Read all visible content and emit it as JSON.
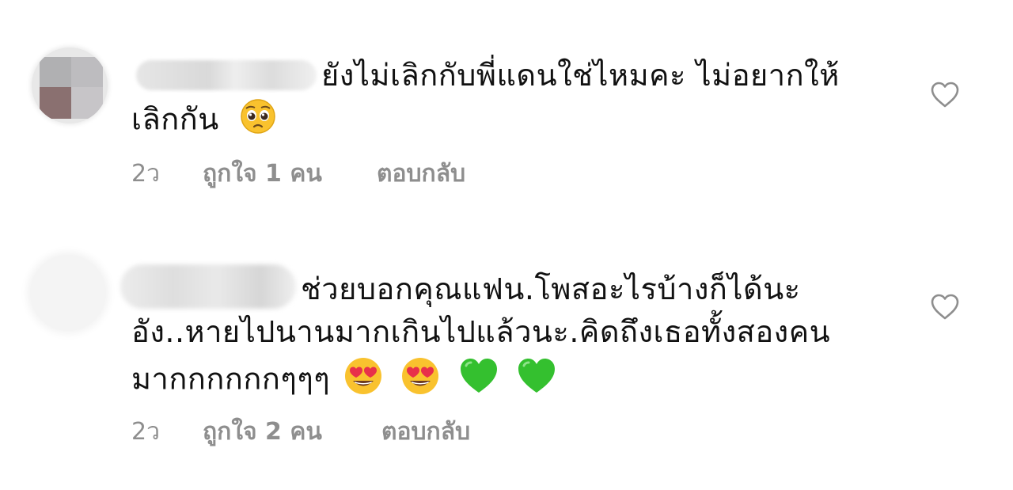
{
  "comments": [
    {
      "text_line1": "ยังไม่เลิกกับพี่แดนใช่ไหมคะ ไม่อยากให้",
      "text_line2": "เลิกกัน",
      "time": "2ว",
      "likes": "ถูกใจ 1 คน",
      "reply": "ตอบกลับ",
      "emoji": [
        "pleading-face"
      ]
    },
    {
      "text_line1": "ช่วยบอกคุณแฟน.โพสอะไรบ้างก็ได้นะ",
      "text_line2": "อัง..หายไปนานมากเกินไปแล้วนะ.คิดถึงเธอทั้งสองคน",
      "text_line3": "มากกกกกกๆๆๆ",
      "time": "2ว",
      "likes": "ถูกใจ 2 คน",
      "reply": "ตอบกลับ",
      "emoji": [
        "heart-eyes-face",
        "heart-eyes-face",
        "green-heart",
        "green-heart"
      ]
    }
  ],
  "icons": {
    "like": "heart-outline-icon"
  },
  "colors": {
    "text": "#111111",
    "meta": "#8e8e8e",
    "icon": "#8e8e8e",
    "emoji_yellow": "#f9c22e",
    "green_heart": "#34c02f"
  }
}
